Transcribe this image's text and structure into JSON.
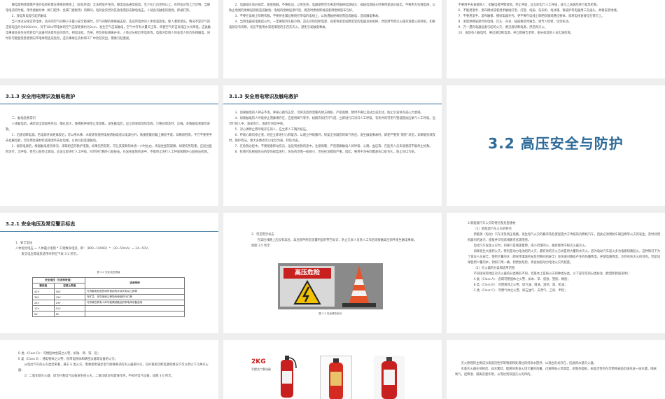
{
  "slides": {
    "s1": {
      "paragraphs": [
        "静电是物体摩擦产生的电荷积累在绝缘的物体上（如化纤类）无法释放产生的。静电电压通常很高，至少在几百伏特以上，有时会达到上万伏特。当静电电流的时候，用手接触导体（如门把手、金属门窗框等）的瞬间，电荷会突然对其放电而形成静电电击，人就会有触电的感觉，即被打到。",
        "2．放电及电弧引起的触电",
        "当人体过分接近带电体，其间的空气间隙小于最小安全距离时，空气间隙的绝缘被击穿，造成带电体对人体电弧放电，使人遭受损伤。情况不是空气的击穿电压约为600kV/m，对于10kV带电体的空气击穿距离约为2cm，发生空气击穿触电，空气中存有大量天尘等，将使空气的击穿电压大大降低。这类触电事故多发生在检修电气设备时违章作业的场合，例如误拉、合闸、带负荷投隔离开关，人体过分接近带电体等。电弧闪烁则人体会受人体灼伤和触电，同时有可能使受害者倒向带电体而造成危险，还有事故在农村和工厂中比较突出，需要引起重视。"
      ]
    },
    "s2": {
      "paragraphs": [
        "2．电器插头易必插牢，紧密接触，不要松动，以免生热。电器使用完毕要及时拔掉电源插头；插拔电源插头时要用紧插头拔出，不要用力拉拽电线，以防止电线的绝缘层受损造成触电；电线的绝缘层损坏后，要及时更换新线或者用绝缘胶布包好。",
        "3．不要在电线上晾晒衣服，不要将金属丝缠绕在带电的电线上，以防遇破绝缘层而造成触电，造成触电事故。",
        "4．当用电器或电路起火时，一定要保持头脑冷静，首先尽快切断电源，或者将家里或教室里的电器总闸关掉，然后用专用灭火器对准着火处喷射。如果电源没有切断，切忌不能用水或者潮湿的东西去灭火，避免引发触电事故。"
      ]
    },
    "s3": {
      "paragraphs": [
        "不要用手去直接救人；如触电者伸臂接地，停止呼吸，应立即实行人工呼吸，或马上送医院进行紧急抢救。",
        "6．不能用湿手、湿布擦拭或者湿手触碰灯泡、灯管、电扇、洗衣机、电冰箱、微波炉等电器用三孔插头，并要安装地线。",
        "7．不要用湿手、湿布触摸、擦拭电器外壳，更不要在电线上晾晒衣服或悬挂物体，或将电线直接挂在铁钉上。",
        "8．发现绝缘层损坏的电线、灯头、开关、插座要及时报告，请专人检修，切勿私动。",
        "9．万一遇有电器设备引起的火灾，要迅速切断电源，然后再灭火。",
        "10．发现有人触电时，要迅速切断电源，并立即报告老师，家长或其他人员实施抢救。"
      ]
    },
    "s4": {
      "title": "3.1.3  安全用电常识及触电救护",
      "paragraphs": [
        "二、触电急救常识",
        "人体触电后，通常会出现面色苍白、瞳孔放大、脉搏和呼吸停止等现象。发生触电后，应立即采取现场急救，只要处理及时、正确，多数触电者都可获救。",
        "1．迅速切断电源。若电源开关距离较近，可以用木棒、木板等快速用电线将触电者与电源分开，救援者最好戴上橡胶手套、穿橡胶鞋等，千万不要用手去拉触电者，切勿用金属材料或潮湿手去拉电线，以防引起连锁触电。",
        "2．据测电源后，根据触电者伤情况，采取相应的救护措施。如果伤势较轻，可让其安静的休息一小时左右，再送往医院观察。如果伤势较重，应送往医院治疗，无呼吸、甚至心脏停止跳动，应该立即进行人工呼吸，同时进行胸外心脏按压。在送往医院的途中，不能停止进行人工呼吸和胸外心脏按压抢救。"
      ]
    },
    "s5": {
      "title": "3.1.3  安全用电常识及触电救护",
      "paragraphs": [
        "3．如果触电的人神志不清，呼吸心跳均正常，可将其放到温暖的地方静卧，严密观察，暂时不要让其站立或走动，防止引发休克或心力衰竭。",
        "4．如果触电的人呼吸停止而脉搏存在，应使用氧气等手，松解衣扣打开气道，立即进行口对口人工呼吸，有条件的可用气管插管加压氧气人工呼吸。当可针刺人中、涌泉等穴，或者针刺及中枢。",
        "5．对心搏停止而呼吸存在的人，应立即人工胸外按压。",
        "6．呼吸心跳均停止者，则应立即进行心肺复苏，以建立呼吸循环，恢复全身器官的氧气供应。发生触电事故时，即使严重到“假死”状态，如果能抢救及时，救护得法，绝大多数也可以化险为夷，转危为安。",
        "7．在抢救过程中，不要随意移动伤员，运送到抢救的途中，注意保暖，严密观察触电人的呼吸、心跳、血压等，在医务人员未接替前不能停止抢救。",
        "8．抢救时应根据伤员的受伤程度进行，伤伤的范围一般很小，但往往深都较严重。因此，要用干净布料覆盖伤口处包扎，防止伤口污染。"
      ]
    },
    "s6": {
      "title": "3.2  高压安全与防护"
    },
    "s7": {
      "title": "3.2.1  安全电压及常见警示标志",
      "paragraphs": [
        "1．安全电压",
        "人体危险电压 = 人体最小电阻 * 工频致命电流，即：（800~1000Ω）*（30~50mA）= 24~50V。",
        "安全电压等级及适用举例见下表 3-2 所示。"
      ],
      "table": {
        "caption": "表 3-2 安全电压等级",
        "headers": [
          "安全电压（交流有效值）",
          "选用举例"
        ],
        "subheaders": [
          "额定值",
          "空载上限值"
        ],
        "rows": [
          [
            "42V",
            "50V",
            "在有触电危险的场所使用的手持式电动工具等"
          ],
          [
            "36V",
            "43V",
            "在矿井、多导电粉尘等场所使用的行灯等"
          ],
          [
            "24V",
            "29V",
            "可供某些具有人体可能偶然触及的带电体设备选用"
          ],
          [
            "12V",
            "15V",
            ""
          ],
          [
            "6V",
            "8V",
            ""
          ]
        ]
      }
    },
    "s8": {
      "paragraphs": [
        "2．常见警示标志",
        "在高压线路上应设有高压、高压部件附近放置明显的警告标识，防止无关人员进入工作区域接触高压部件发生触电事故。如图 3.5 所示"
      ],
      "sign_text": "高压危险",
      "caption": "图 3.5  安全警告标识"
    },
    "s9": {
      "paragraphs": [
        "3.新能源汽车火灾的特点及危害建材",
        "（1）新能源汽车火灾的特点",
        "新能源（电动）汽车涉及高压电路，发生电气火灾的概率及危害程度大于传统的内燃机汽车，因此必须预防车辆自燃等火灾的发生，及时处理机器内的油污、提拔并识别成线路老化等隐患。",
        "电动汽车发生火灾时，如果只是线束着燃，或小范围的火，推荐使用干粉灭火器灭火。",
        "如果发生大面积火灾，特别是动力电池组的火灾，最有效的灭火方式是用大量的水灭火。因为电动汽车起火多为电路短路起火，这种情况下为了保证人员安全，使用大量的水（即采用灌溉的技及时瞬间的安全）会快速对路段产生的热量降温，并使电路降温，达到有效灭火的目的。但是如果使用少量的水，例如只用一桶、则更加危险，将会加剧动力电池火灾的程度。",
        "（2）灭火器的分类和适用范围",
        "不同国家和地区对灭火器的分类略有不同，但基本上是按火灾的种类分类。以下是常见的分类标准（欧盟和我国采用）：",
        "A 类（Class A）：含碳可燃固体之火警，如木、草、纸张、塑胶、橡胶；",
        "B 类（Class B）：可燃液体之火警，如汽油、煤油、溶剂、酒、机油；",
        "C 类（Class C）：可燃气体之火警，如石油气、天然气、乙炔、甲烷；"
      ]
    },
    "s10": {
      "paragraphs": [
        "D 类（Class D）：可燃固体金属之火警，如钠、钾、铁、铝；",
        "E 类（Class E）：通电物体之火警，指带电物体和精密仪器等设备的火灾。",
        "从电动汽车的火灾类型来看，属于 E 类火灾，需要使用满足电气绝缘要求的灭火器来扑灭。在扑救来切断电源的情况下可以用以下几种灭火器：",
        "1）二氧化碳灭火器：适合扑救电气设备发生的火灾。二氧化碳没有腐蚀作用，不损坏电气设备，如图 3.6 所示。"
      ]
    },
    "s11": {
      "label": "2KG",
      "sublabel": "手提式二氧化碳"
    },
    "s12": {
      "paragraphs": [
        "灭火原理的主要成分表面活性剂等物质和处理过的纯净水搅拌，以通古形式存在，因此称水基灭火器。",
        "水基灭火器在喷射后，成水雾状，能瞬间蒸发火场大量的热量，迅速降低火场温度，抑制热辐射。表面活性剂在可燃物表面迅速形成一层水膜，隔离氧气，起降温、隔离双重作用，从而达到快速灭火的目的。"
      ]
    },
    "colors": {
      "accent": "#2d6a98",
      "sign_red": "#c8201e",
      "cone_orange": "#e8542a"
    }
  }
}
